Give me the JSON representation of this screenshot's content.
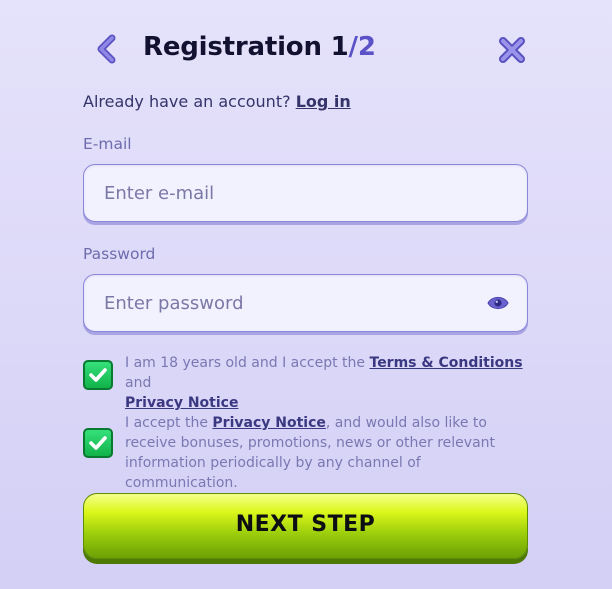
{
  "header": {
    "title_main": "Registration 1",
    "title_sep": "/",
    "title_total": "2"
  },
  "login": {
    "prompt": "Already have an account?",
    "link": "Log in"
  },
  "email": {
    "label": "E-mail",
    "placeholder": "Enter e-mail",
    "value": ""
  },
  "password": {
    "label": "Password",
    "placeholder": "Enter password",
    "value": ""
  },
  "consent_age": {
    "checked": true,
    "text_before": "I am 18 years old and I accept the ",
    "terms_link": "Terms & Conditions",
    "text_mid": " and ",
    "privacy_link": "Privacy Notice"
  },
  "consent_marketing": {
    "checked": true,
    "text_before": "I accept the ",
    "privacy_link": "Privacy Notice",
    "text_after": ", and would also like to receive bonuses, promotions, news or other relevant information periodically by any channel of communication."
  },
  "next_button": {
    "label": "NEXT STEP"
  },
  "icons": {
    "back": "chevron-left-icon",
    "close": "close-x-icon",
    "show_password": "eye-icon",
    "checkmark": "checkmark-icon"
  },
  "colors": {
    "accent": "#5c52c7",
    "background": "#dcd8f8",
    "checkbox_green": "#12b24a",
    "button_lime": "#9fd00c"
  }
}
